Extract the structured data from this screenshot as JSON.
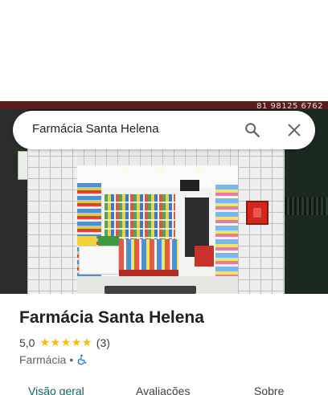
{
  "search": {
    "query": "Farmácia Santa Helena"
  },
  "photo": {
    "phone_text": "81 98125 6762"
  },
  "place": {
    "name": "Farmácia Santa Helena",
    "rating": "5,0",
    "star_count": 5,
    "review_count": "(3)",
    "category": "Farmácia",
    "separator": "•"
  },
  "tabs": [
    {
      "label": "Visão geral",
      "active": true
    },
    {
      "label": "Avaliações",
      "active": false
    },
    {
      "label": "Sobre",
      "active": false
    }
  ],
  "colors": {
    "accent": "#0b6a63",
    "star": "#fbbc04",
    "accessibility_icon": "#1a73e8"
  },
  "icons": {
    "search": "search-icon",
    "close": "close-icon",
    "star": "star-icon",
    "accessibility": "wheelchair-accessible-icon"
  }
}
